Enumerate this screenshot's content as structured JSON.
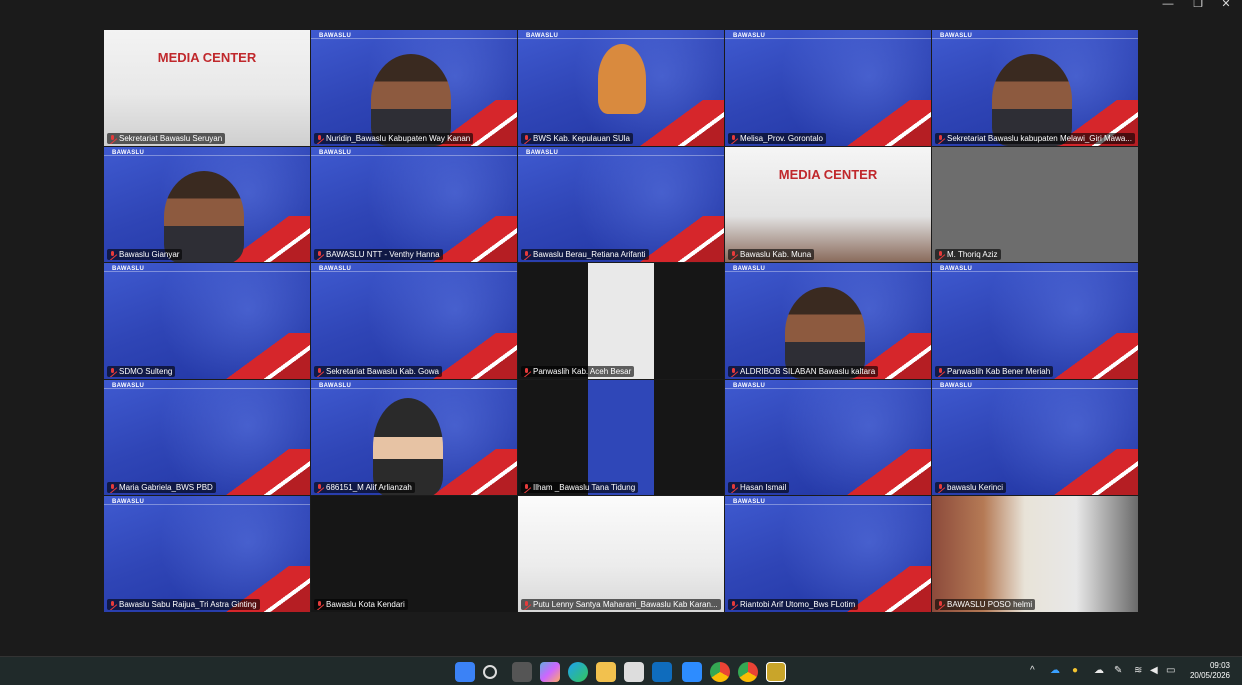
{
  "window_controls": {
    "minimize": "—",
    "restore": "❐",
    "close": "✕"
  },
  "brand_text": "BAWASLU",
  "media_center_text": "MEDIA CENTER",
  "tiles": [
    {
      "name": "Sekretariat Bawaslu Seruyan",
      "kind": "room"
    },
    {
      "name": "Nuridin_Bawaslu Kabupaten Way Kanan",
      "kind": "slide-person"
    },
    {
      "name": "BWS Kab. Kepulauan SUla",
      "kind": "slide-avatar-cat"
    },
    {
      "name": "Melisa_Prov. Gorontalo",
      "kind": "slide"
    },
    {
      "name": "Sekretariat Bawaslu kabupaten Melawi_Giri Mawa...",
      "kind": "slide-person"
    },
    {
      "name": "Bawaslu Gianyar",
      "kind": "slide-person"
    },
    {
      "name": "BAWASLU NTT - Venthy Hanna",
      "kind": "slide"
    },
    {
      "name": "Bawaslu Berau_Retiana Arifanti",
      "kind": "slide"
    },
    {
      "name": "Bawaslu Kab. Muna",
      "kind": "room2"
    },
    {
      "name": "M. Thoriq Aziz",
      "kind": "gray"
    },
    {
      "name": "SDMO Sulteng",
      "kind": "slide"
    },
    {
      "name": "Sekretariat Bawaslu Kab. Gowa",
      "kind": "slide"
    },
    {
      "name": "Panwaslih Kab. Aceh Besar",
      "kind": "dark-strip"
    },
    {
      "name": "ALDRIBOB SILABAN Bawaslu kaltara",
      "kind": "slide-person"
    },
    {
      "name": "Panwaslih Kab Bener Meriah",
      "kind": "slide"
    },
    {
      "name": "Maria Gabriela_BWS PBD",
      "kind": "slide"
    },
    {
      "name": "686151_M Alif Arlianzah",
      "kind": "slide-avatar"
    },
    {
      "name": "Ilham _Bawaslu Tana Tidung",
      "kind": "dark-strip-blue"
    },
    {
      "name": "Hasan Ismail",
      "kind": "slide"
    },
    {
      "name": "bawaslu Kerinci",
      "kind": "slide"
    },
    {
      "name": "Bawaslu Sabu Raijua_Tri Astra Ginting",
      "kind": "slide"
    },
    {
      "name": "Bawaslu Kota Kendari",
      "kind": "dark"
    },
    {
      "name": "Putu Lenny Santya Maharani_Bawaslu Kab Karan...",
      "kind": "doc"
    },
    {
      "name": "Riantobi Arif Utomo_Bws FLotim",
      "kind": "slide"
    },
    {
      "name": "BAWASLU POSO helmi",
      "kind": "office"
    }
  ],
  "taskbar": {
    "icons": [
      "windows-start",
      "search",
      "task-view",
      "copilot",
      "edge",
      "file-explorer",
      "store",
      "outlook",
      "zoom",
      "chrome",
      "chrome-2",
      "app"
    ],
    "tray": [
      "chevron-up",
      "onedrive",
      "security",
      "cloud",
      "pen",
      "wifi",
      "volume",
      "battery"
    ],
    "time": "09:03",
    "date": "20/05/2026"
  }
}
